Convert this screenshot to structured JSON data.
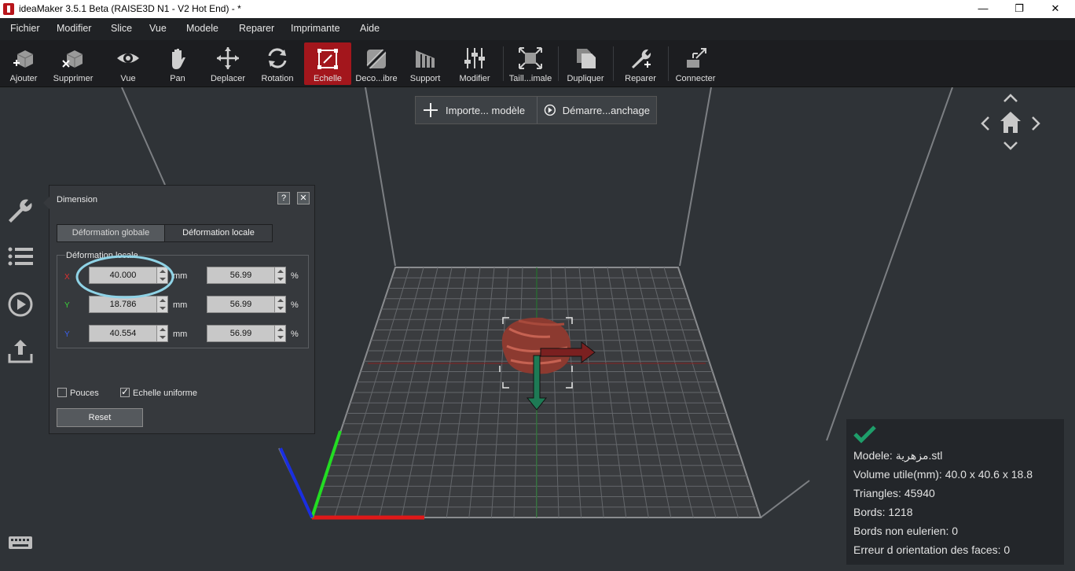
{
  "window": {
    "title": "ideaMaker 3.5.1 Beta (RAISE3D N1 - V2 Hot End) - *",
    "minimize": "—",
    "restore": "❐",
    "close": "✕"
  },
  "menu": [
    "Fichier",
    "Modifier",
    "Slice",
    "Vue",
    "Modele",
    "Reparer",
    "Imprimante",
    "Aide"
  ],
  "toolbar": {
    "ajouter": "Ajouter",
    "supprimer": "Supprimer",
    "vue": "Vue",
    "pan": "Pan",
    "deplacer": "Deplacer",
    "rotation": "Rotation",
    "echelle": "Echelle",
    "decoupe": "Deco...ibre",
    "support": "Support",
    "modifier": "Modifier",
    "taille": "Taill...imale",
    "dupliquer": "Dupliquer",
    "reparer": "Reparer",
    "connecter": "Connecter",
    "active_color": "#a3161c"
  },
  "actions": {
    "import": "Importe... modèle",
    "start": "Démarre...anchage"
  },
  "dimension": {
    "title": "Dimension",
    "help": "?",
    "close": "✕",
    "tab_global": "Déformation globale",
    "tab_local": "Déformation locale",
    "group_label": "Déformation locale",
    "rows": [
      {
        "axis": "X",
        "axis_color": "#e03030",
        "mm": "40.000",
        "unit": "mm",
        "pct": "56.99",
        "pct_unit": "%"
      },
      {
        "axis": "Y",
        "axis_color": "#3ad03a",
        "mm": "18.786",
        "unit": "mm",
        "pct": "56.99",
        "pct_unit": "%"
      },
      {
        "axis": "Y",
        "axis_color": "#3a60f0",
        "mm": "40.554",
        "unit": "mm",
        "pct": "56.99",
        "pct_unit": "%"
      }
    ],
    "pouces": "Pouces",
    "pouces_checked": false,
    "uniforme": "Echelle uniforme",
    "uniforme_checked": true,
    "reset": "Reset"
  },
  "info": {
    "check_color": "#1e9e6a",
    "lines": [
      "Modele: مزهرية.stl",
      "Volume utile(mm): 40.0 x 40.6 x 18.8",
      "Triangles: 45940",
      "Bords: 1218",
      "Bords non eulerien: 0",
      "Erreur d orientation des faces: 0"
    ]
  }
}
